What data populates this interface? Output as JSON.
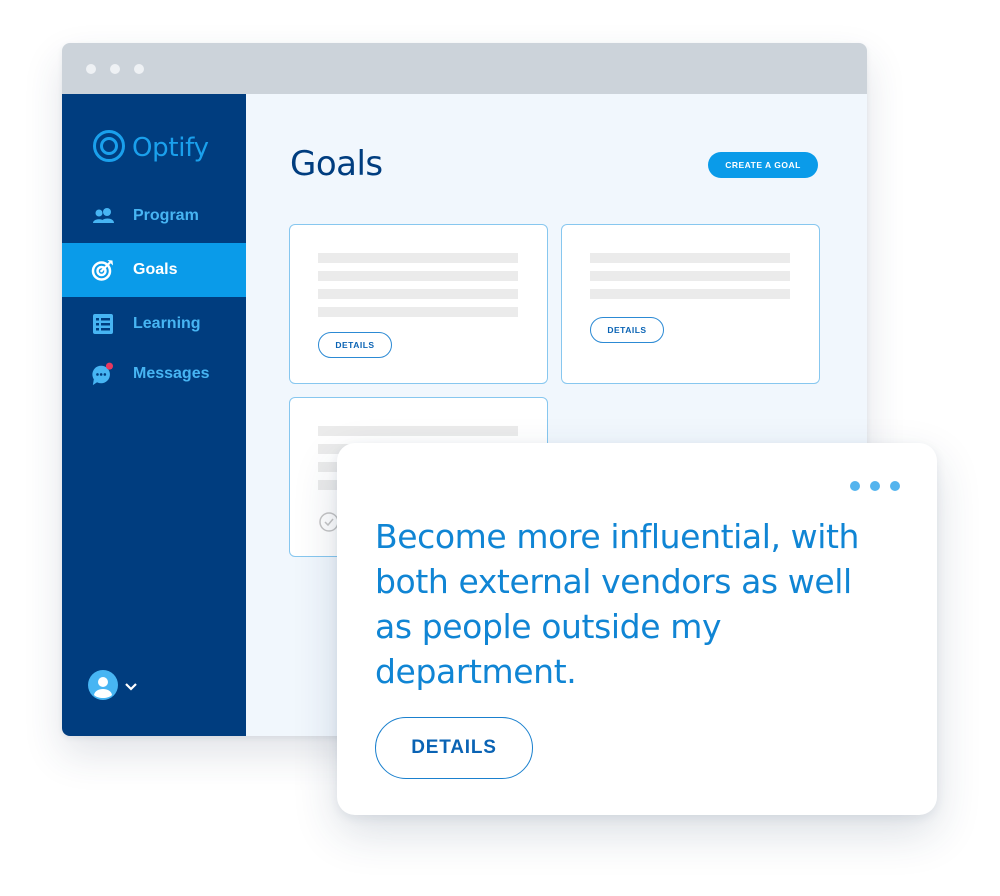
{
  "app": {
    "name": "Optify"
  },
  "sidebar": {
    "items": [
      {
        "label": "Program",
        "icon": "people-icon",
        "active": false
      },
      {
        "label": "Goals",
        "icon": "target-icon",
        "active": true
      },
      {
        "label": "Learning",
        "icon": "list-icon",
        "active": false
      },
      {
        "label": "Messages",
        "icon": "chat-bubble-icon",
        "active": false,
        "badge": true
      }
    ],
    "user_menu": {
      "icon": "avatar-icon",
      "chevron": "chevron-down-icon"
    }
  },
  "main": {
    "title": "Goals",
    "create_button": "CREATE A GOAL",
    "cards": [
      {
        "details_label": "DETAILS"
      },
      {
        "details_label": "DETAILS"
      },
      {
        "status_icon": "check-circle-icon"
      }
    ]
  },
  "popup": {
    "goal_text": "Become more influential, with both external vendors as well as people outside my department.",
    "details_label": "DETAILS",
    "menu_icon": "more-dots-icon"
  },
  "colors": {
    "sidebar": "#003d7f",
    "accent": "#0a9be9",
    "content_bg": "#f1f7fd",
    "popup_text": "#1085d4",
    "notification": "#e8385f"
  }
}
